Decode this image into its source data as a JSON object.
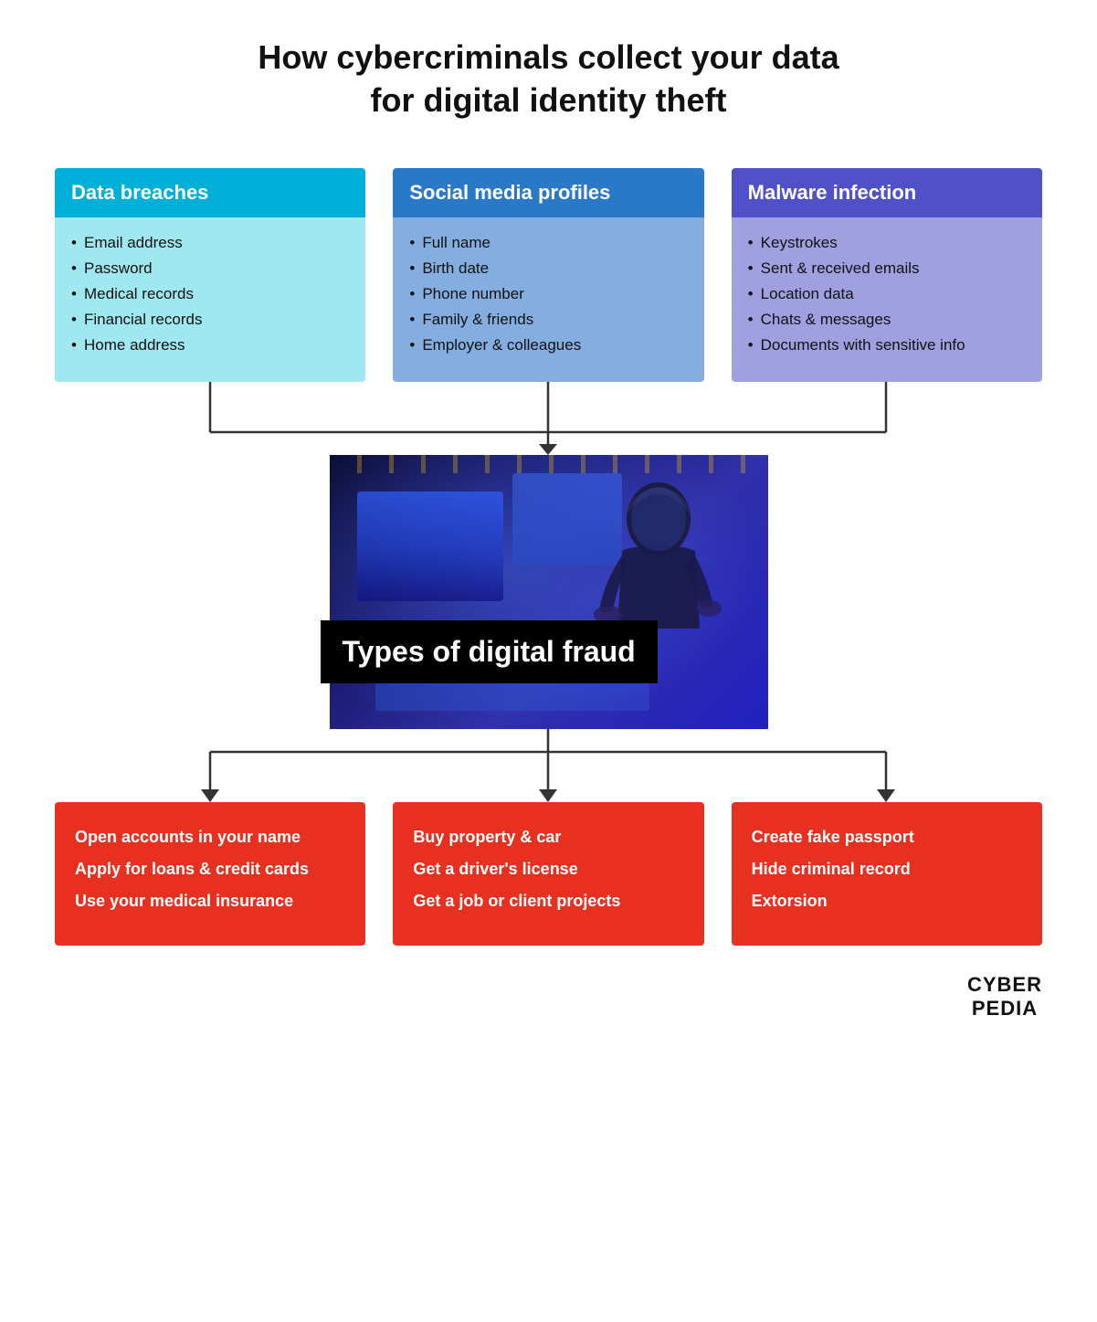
{
  "page": {
    "title_line1": "How cybercriminals collect your data",
    "title_line2": "for digital identity theft"
  },
  "top_boxes": [
    {
      "id": "data-breaches",
      "header": "Data breaches",
      "color_class": "box-cyan",
      "items": [
        "Email address",
        "Password",
        "Medical records",
        "Financial records",
        "Home address"
      ]
    },
    {
      "id": "social-media",
      "header": "Social media profiles",
      "color_class": "box-blue",
      "items": [
        "Full name",
        "Birth date",
        "Phone number",
        "Family & friends",
        "Employer & colleagues"
      ]
    },
    {
      "id": "malware",
      "header": "Malware infection",
      "color_class": "box-purple",
      "items": [
        "Keystrokes",
        "Sent & received emails",
        "Location data",
        "Chats & messages",
        "Documents with sensitive info"
      ]
    }
  ],
  "center": {
    "fraud_label": "Types of digital fraud"
  },
  "bottom_boxes": [
    {
      "id": "financial-fraud",
      "lines": [
        "Open accounts in your name",
        "Apply for loans & credit cards",
        "Use your medical insurance"
      ]
    },
    {
      "id": "identity-fraud",
      "lines": [
        "Buy property & car",
        "Get a driver's license",
        "Get a job or client projects"
      ]
    },
    {
      "id": "document-fraud",
      "lines": [
        "Create fake passport",
        "Hide criminal record",
        "Extorsion"
      ]
    }
  ],
  "logo": {
    "line1": "CYBER",
    "line2": "PEDIA"
  }
}
